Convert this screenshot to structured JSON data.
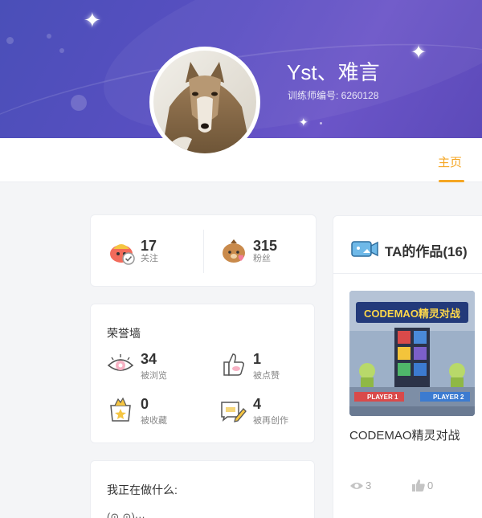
{
  "profile": {
    "username": "Yst、难言",
    "trainer_id": "训练师编号: 6260128"
  },
  "nav": {
    "home_label": "主页"
  },
  "stats": {
    "following": {
      "count": "17",
      "label": "关注"
    },
    "fans": {
      "count": "315",
      "label": "粉丝"
    }
  },
  "honor": {
    "title": "荣誉墙",
    "items": [
      {
        "count": "34",
        "label": "被浏览",
        "icon": "eye-icon"
      },
      {
        "count": "1",
        "label": "被点赞",
        "icon": "thumbs-up-icon"
      },
      {
        "count": "0",
        "label": "被收藏",
        "icon": "star-box-icon"
      },
      {
        "count": "4",
        "label": "被再创作",
        "icon": "pencil-card-icon"
      }
    ]
  },
  "doing": {
    "title": "我正在做什么:",
    "text": "(⊙ˍ⊙)···"
  },
  "works": {
    "title": "TA的作品(16)",
    "items": [
      {
        "name": "CODEMAO精灵对战",
        "thumb_title": "CODEMAO精灵对战",
        "player1": "PLAYER 1",
        "player2": "PLAYER 2",
        "views": "3",
        "likes": "0"
      }
    ]
  },
  "colors": {
    "accent": "#f5a623",
    "banner": "#5a4fc2"
  }
}
